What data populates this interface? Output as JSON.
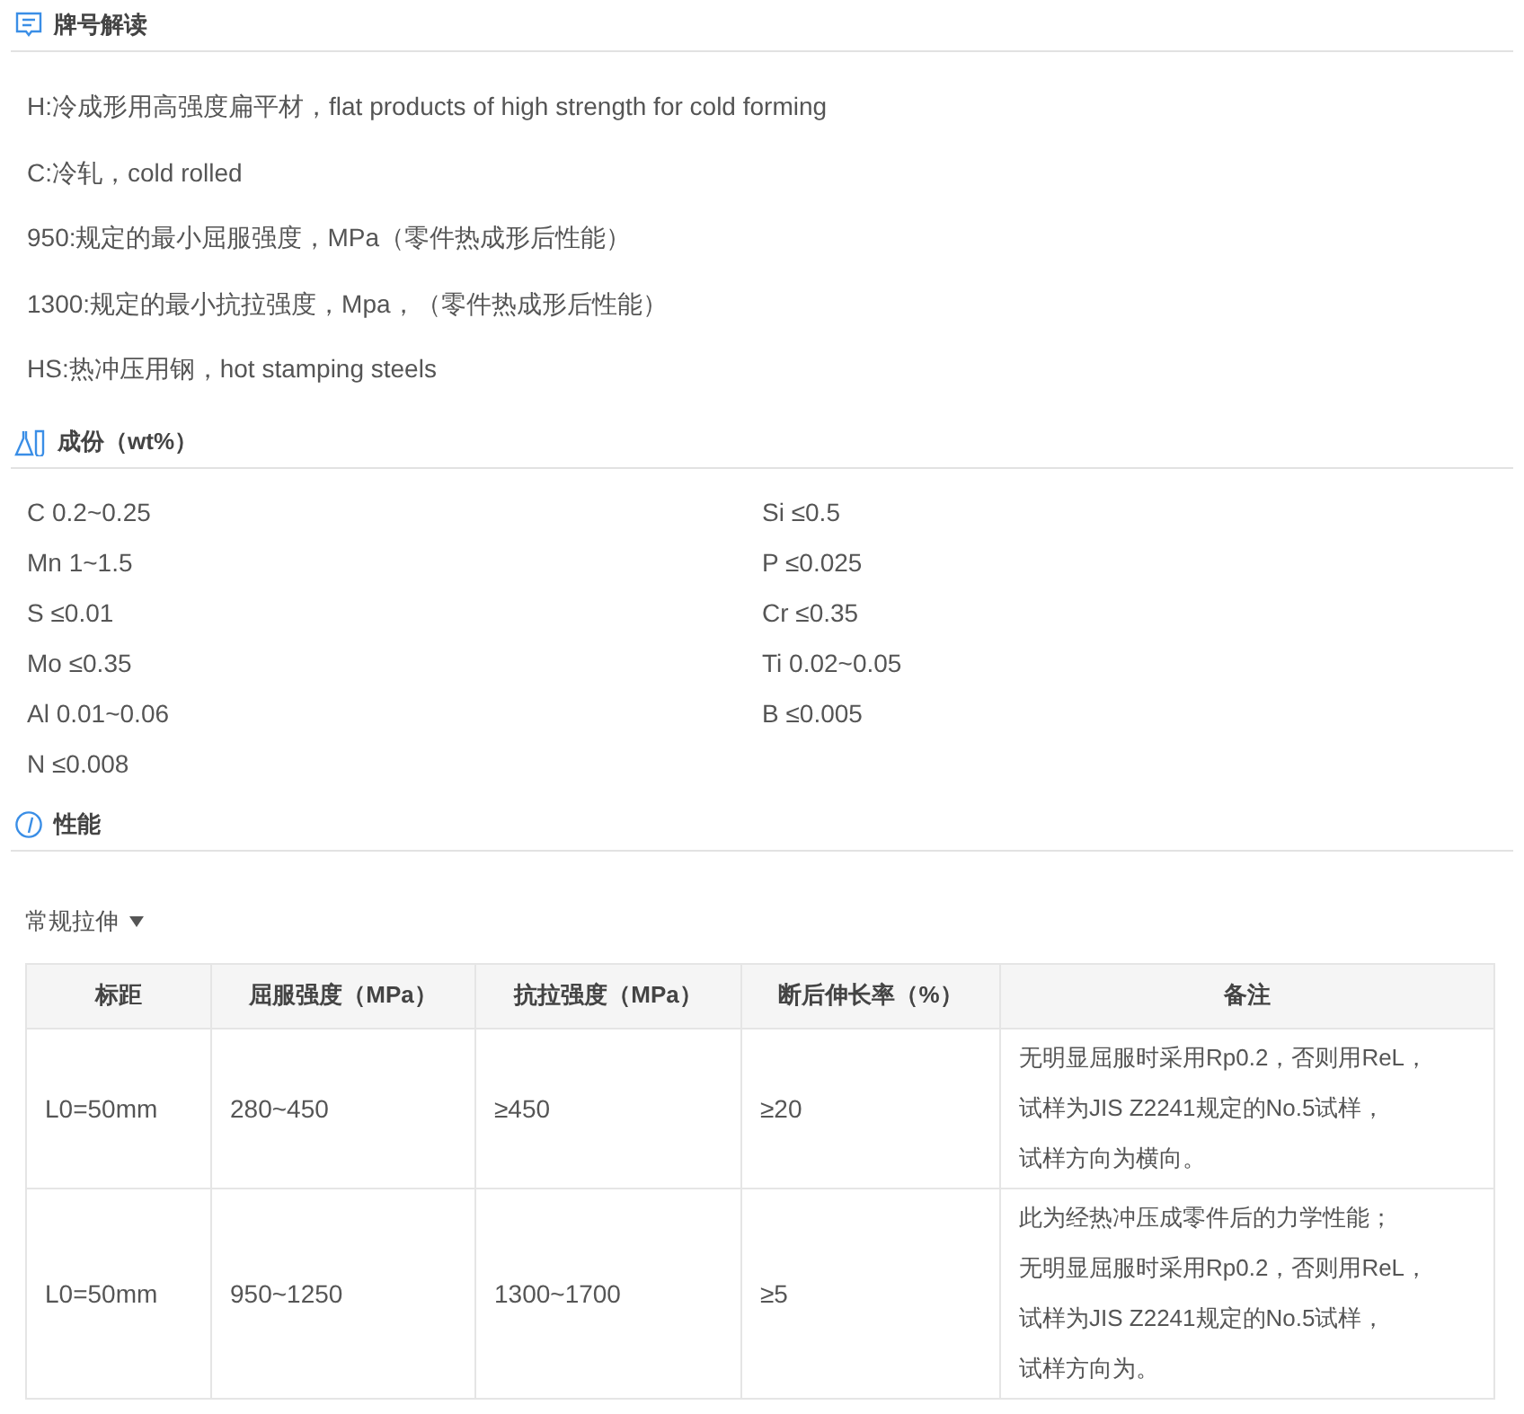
{
  "sections": [
    {
      "kind": "lines",
      "title": "牌号解读",
      "lines": [
        "H:冷成形用高强度扁平材，flat products of high strength for cold forming",
        "C:冷轧，cold rolled",
        "950:规定的最小屈服强度，MPa（零件热成形后性能）",
        "1300:规定的最小抗拉强度，Mpa，（零件热成形后性能）",
        "HS:热冲压用钢，hot stamping steels"
      ]
    },
    {
      "kind": "grid",
      "title": "成份（wt%）",
      "items": [
        "C 0.2~0.25",
        "Si ≤0.5",
        "Mn 1~1.5",
        "P ≤0.025",
        "S ≤0.01",
        "Cr ≤0.35",
        "Mo ≤0.35",
        "Ti 0.02~0.05",
        "Al 0.01~0.06",
        "B ≤0.005",
        "N ≤0.008"
      ]
    },
    {
      "kind": "table",
      "title": "性能",
      "dropdown": "常规拉伸",
      "columns": [
        "标距",
        "屈服强度（MPa）",
        "抗拉强度（MPa）",
        "断后伸长率（%）",
        "备注"
      ],
      "rows": [
        {
          "cells": [
            "L0=50mm",
            "280~450",
            "≥450",
            "≥20"
          ],
          "remarks": [
            "无明显屈服时采用Rp0.2，否则用ReL，",
            "试样为JIS Z2241规定的No.5试样，",
            "试样方向为横向。"
          ]
        },
        {
          "cells": [
            "L0=50mm",
            "950~1250",
            "1300~1700",
            "≥5"
          ],
          "remarks": [
            "此为经热冲压成零件后的力学性能；",
            "无明显屈服时采用Rp0.2，否则用ReL，",
            "试样为JIS Z2241规定的No.5试样，",
            "试样方向为。"
          ]
        }
      ]
    }
  ]
}
